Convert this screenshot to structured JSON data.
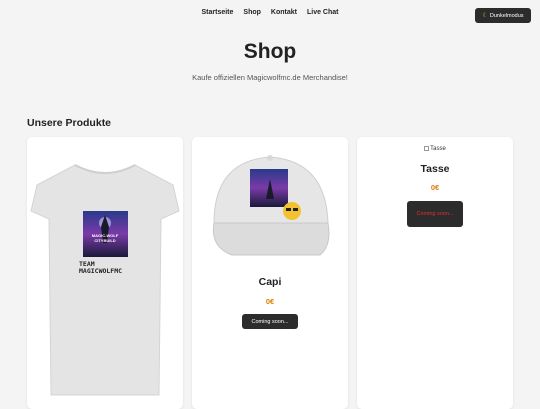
{
  "nav": {
    "items": [
      "Startseite",
      "Shop",
      "Kontakt",
      "Live Chat"
    ]
  },
  "dark_mode": {
    "icon": "moon-icon",
    "label": "Dunkelmodus"
  },
  "hero": {
    "title": "Shop",
    "subtitle": "Kaufe offiziellen Magicwolfmc.de Merchandise!"
  },
  "products_section": {
    "title": "Unsere Produkte"
  },
  "products": [
    {
      "name": "",
      "image_text": "TEAM MAGICWOLFMC",
      "artwork_text": "MAGIC-WOLF CITYBUILD"
    },
    {
      "name": "Capi",
      "price": "0€",
      "button": "Coming soon...",
      "artwork_text": "MAGIC-WOLF CITYBUILD"
    },
    {
      "name": "Tasse",
      "price": "0€",
      "button": "Coming soon...",
      "image_alt": "Tasse"
    }
  ],
  "colors": {
    "price": "#e07b00",
    "button_bg": "#2c2c2c",
    "button_text_card2": "#ffffff",
    "button_text_card3": "#e03030"
  }
}
